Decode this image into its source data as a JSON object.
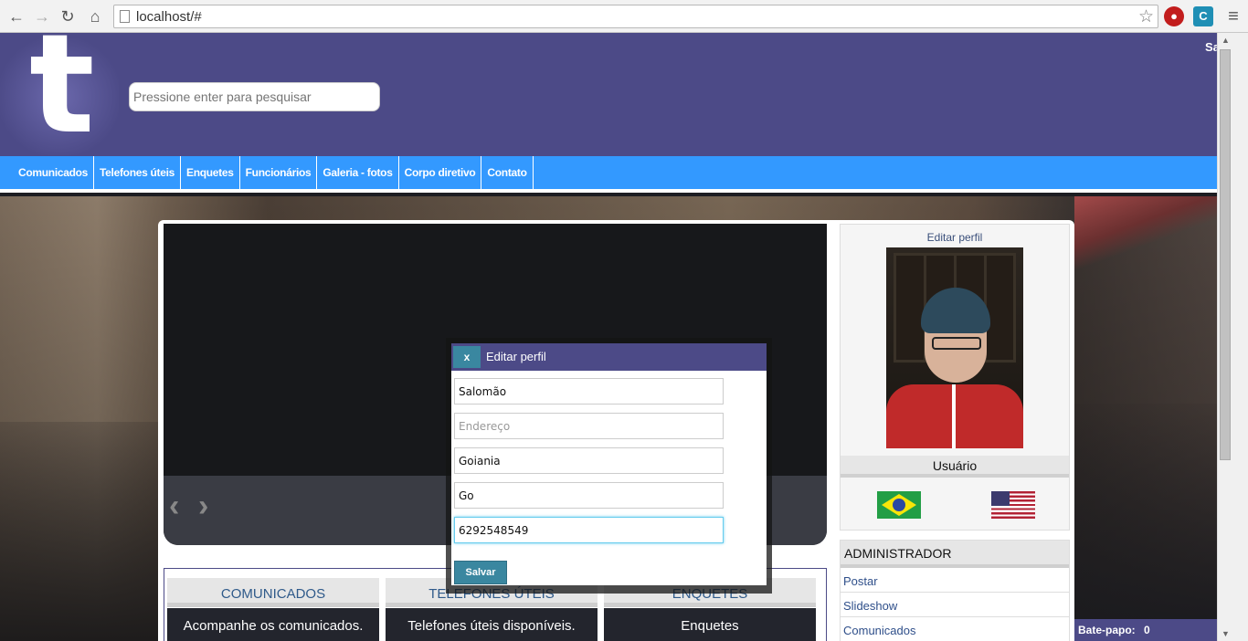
{
  "browser": {
    "url": "localhost/#",
    "back_icon": "←",
    "forward_icon": "→",
    "reload_icon": "↻",
    "home_icon": "⌂",
    "star_icon": "☆",
    "menu_icon": "≡"
  },
  "header": {
    "logo_letter": "t",
    "search_placeholder": "Pressione enter para pesquisar",
    "top_right_text": "Sa"
  },
  "menu": {
    "items": [
      "Comunicados",
      "Telefones úteis",
      "Enquetes",
      "Funcionários",
      "Galeria - fotos",
      "Corpo diretivo",
      "Contato"
    ]
  },
  "slider": {
    "prev": "‹",
    "next": "›"
  },
  "boxes": [
    {
      "title": "COMUNICADOS",
      "text": "Acompanhe os comunicados."
    },
    {
      "title": "TELEFONES ÚTEIS",
      "text": "Telefones úteis disponíveis."
    },
    {
      "title": "ENQUETES",
      "text": "Enquetes"
    }
  ],
  "profile": {
    "edit_link": "Editar perfil",
    "user_label": "Usuário"
  },
  "admin": {
    "title": "ADMINISTRADOR",
    "items": [
      "Postar",
      "Slideshow",
      "Comunicados"
    ]
  },
  "chat": {
    "label": "Bate-papo:",
    "count": "0"
  },
  "modal": {
    "close_label": "x",
    "title": "Editar perfil",
    "fields": {
      "name": "Salomão",
      "address_placeholder": "Endereço",
      "city": "Goiania",
      "state": "Go",
      "phone": "6292548549"
    },
    "save_label": "Salvar"
  }
}
